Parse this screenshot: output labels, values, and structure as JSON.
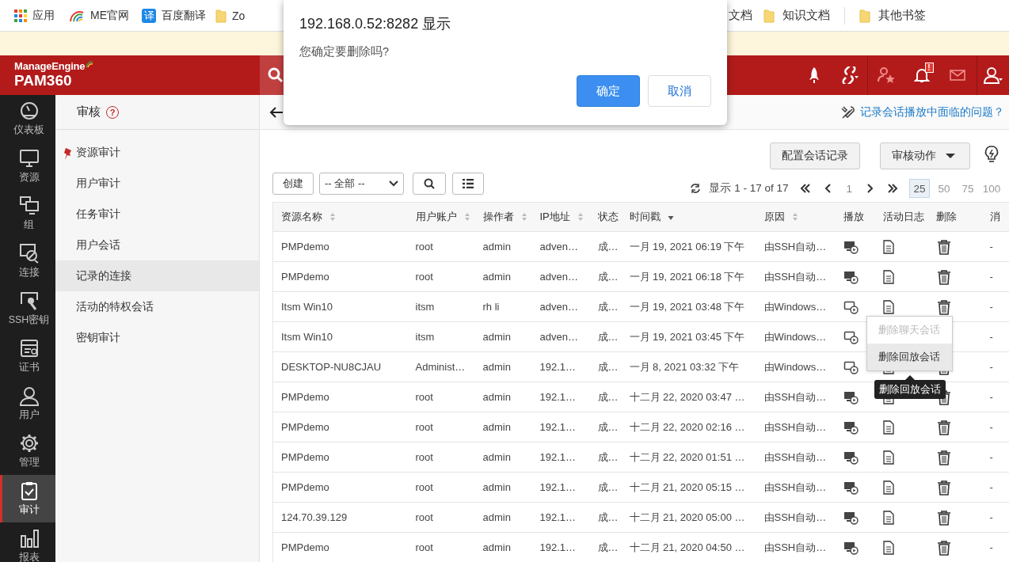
{
  "bookmarks": {
    "left": [
      {
        "kind": "apps",
        "label": "应用"
      },
      {
        "kind": "site",
        "label": "ME官网"
      },
      {
        "kind": "badge",
        "badge": "译",
        "label": "百度翻译"
      },
      {
        "kind": "folder",
        "label": "Zo"
      }
    ],
    "right": [
      {
        "kind": "plain",
        "label": "文档"
      },
      {
        "kind": "folder",
        "label": "知识文档"
      },
      {
        "kind": "folder",
        "label": "其他书签"
      }
    ]
  },
  "header": {
    "brand": "ManageEngine",
    "product": "PAM360",
    "alert_badge": "!"
  },
  "nav": [
    {
      "label": "仪表板",
      "selected": false
    },
    {
      "label": "资源",
      "selected": false
    },
    {
      "label": "组",
      "selected": false
    },
    {
      "label": "连接",
      "selected": false
    },
    {
      "label": "SSH密钥",
      "selected": false
    },
    {
      "label": "证书",
      "selected": false
    },
    {
      "label": "用户",
      "selected": false
    },
    {
      "label": "管理",
      "selected": false
    },
    {
      "label": "审计",
      "selected": true
    },
    {
      "label": "报表",
      "selected": false
    }
  ],
  "submenu": {
    "title": "审核",
    "help": "?",
    "items": [
      {
        "label": "资源审计",
        "pinned": true,
        "selected": false
      },
      {
        "label": "用户审计",
        "pinned": false,
        "selected": false
      },
      {
        "label": "任务审计",
        "pinned": false,
        "selected": false
      },
      {
        "label": "用户会话",
        "pinned": false,
        "selected": false
      },
      {
        "label": "记录的连接",
        "pinned": false,
        "selected": true
      },
      {
        "label": "活动的特权会话",
        "pinned": false,
        "selected": false
      },
      {
        "label": "密钥审计",
        "pinned": false,
        "selected": false
      }
    ]
  },
  "help_link": "记录会话播放中面临的问题？",
  "actions": [
    "配置会话记录",
    "审核动作"
  ],
  "toolbar": {
    "create": "创建",
    "filter": "-- 全部 --"
  },
  "pager": {
    "summary": "显示 1 - 17 of 17",
    "page": "1",
    "sizes": [
      {
        "label": "25",
        "selected": true
      },
      {
        "label": "50",
        "selected": false
      },
      {
        "label": "75",
        "selected": false
      },
      {
        "label": "100",
        "selected": false
      }
    ]
  },
  "table": {
    "columns": [
      {
        "label": "资源名称",
        "sortable": true,
        "sorted": false
      },
      {
        "label": "用户账户",
        "sortable": true,
        "sorted": false
      },
      {
        "label": "操作者",
        "sortable": true,
        "sorted": false
      },
      {
        "label": "IP地址",
        "sortable": true,
        "sorted": false
      },
      {
        "label": "状态",
        "sortable": false,
        "sorted": false
      },
      {
        "label": "时间戳",
        "sortable": true,
        "sorted": true
      },
      {
        "label": "原因",
        "sortable": true,
        "sorted": false
      },
      {
        "label": "播放",
        "sortable": false,
        "sorted": false
      },
      {
        "label": "活动日志",
        "sortable": false,
        "sorted": false
      },
      {
        "label": "删除",
        "sortable": false,
        "sorted": false
      },
      {
        "label": "消",
        "sortable": false,
        "sorted": false
      }
    ],
    "rows": [
      {
        "kind": "filled",
        "cells": [
          "PMPdemo",
          "root",
          "admin",
          "adven…",
          "成…",
          "一月 19, 2021 06:19 下午",
          "由SSH自动…"
        ],
        "last": "-"
      },
      {
        "kind": "filled",
        "cells": [
          "PMPdemo",
          "root",
          "admin",
          "adven…",
          "成…",
          "一月 19, 2021 06:18 下午",
          "由SSH自动…"
        ],
        "last": "-"
      },
      {
        "kind": "outline",
        "cells": [
          "Itsm Win10",
          "itsm",
          "rh li",
          "adven…",
          "成…",
          "一月 19, 2021 03:48 下午",
          "由Windows…"
        ],
        "last": "-"
      },
      {
        "kind": "outline",
        "cells": [
          "Itsm Win10",
          "itsm",
          "admin",
          "adven…",
          "成…",
          "一月 19, 2021 03:45 下午",
          "由Windows…"
        ],
        "last": "-",
        "menu_open": true
      },
      {
        "kind": "outline",
        "cells": [
          "DESKTOP-NU8CJAU",
          "Administ…",
          "admin",
          "192.1…",
          "成…",
          "一月 8, 2021 03:32 下午",
          "由Windows…"
        ],
        "last": "-"
      },
      {
        "kind": "filled",
        "cells": [
          "PMPdemo",
          "root",
          "admin",
          "192.1…",
          "成…",
          "十二月 22, 2020 03:47 …",
          "由SSH自动…"
        ],
        "last": "-"
      },
      {
        "kind": "filled",
        "cells": [
          "PMPdemo",
          "root",
          "admin",
          "192.1…",
          "成…",
          "十二月 22, 2020 02:16 …",
          "由SSH自动…"
        ],
        "last": "-"
      },
      {
        "kind": "filled",
        "cells": [
          "PMPdemo",
          "root",
          "admin",
          "192.1…",
          "成…",
          "十二月 22, 2020 01:51 …",
          "由SSH自动…"
        ],
        "last": "-"
      },
      {
        "kind": "filled",
        "cells": [
          "PMPdemo",
          "root",
          "admin",
          "192.1…",
          "成…",
          "十二月 21, 2020 05:15 …",
          "由SSH自动…"
        ],
        "last": "-"
      },
      {
        "kind": "filled",
        "cells": [
          "124.70.39.129",
          "root",
          "admin",
          "192.1…",
          "成…",
          "十二月 21, 2020 05:00 …",
          "由SSH自动…"
        ],
        "last": "-"
      },
      {
        "kind": "filled",
        "cells": [
          "PMPdemo",
          "root",
          "admin",
          "192.1…",
          "成…",
          "十二月 21, 2020 04:50 …",
          "由SSH自动…"
        ],
        "last": "-"
      }
    ]
  },
  "row_menu": {
    "items": [
      {
        "label": "删除聊天会话",
        "disabled": true,
        "highlighted": false
      },
      {
        "label": "删除回放会话",
        "disabled": false,
        "highlighted": true
      }
    ],
    "tooltip": "删除回放会话"
  },
  "dialog": {
    "title": "192.168.0.52:8282 显示",
    "message": "您确定要删除吗?",
    "buttons": [
      {
        "label": "确定",
        "kind": "primary"
      },
      {
        "label": "取消",
        "kind": "secondary"
      }
    ]
  }
}
